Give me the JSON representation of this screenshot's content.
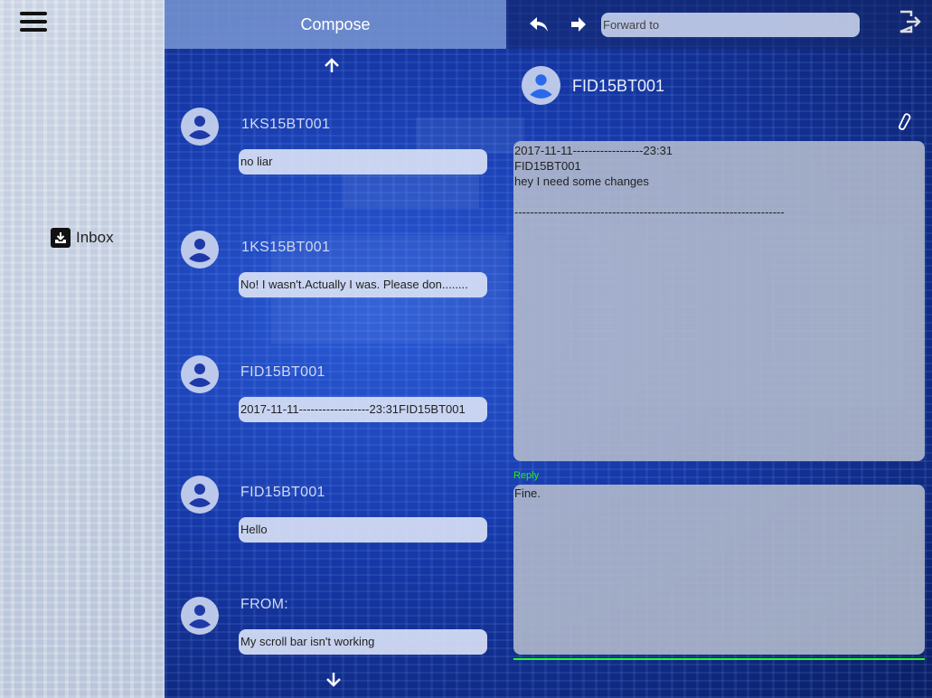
{
  "sidebar": {
    "inbox_label": "Inbox"
  },
  "middle": {
    "compose_label": "Compose",
    "messages": [
      {
        "sender": "1KS15BT001",
        "preview": "no liar"
      },
      {
        "sender": "1KS15BT001",
        "preview": "No! I wasn't.Actually I was. Please don........"
      },
      {
        "sender": "FID15BT001",
        "preview": "2017-11-11------------------23:31FID15BT001"
      },
      {
        "sender": "FID15BT001",
        "preview": "Hello"
      },
      {
        "sender": "FROM:",
        "preview": "My scroll bar isn't working"
      }
    ]
  },
  "right": {
    "forward_placeholder": "Forward to",
    "sender": "FID15BT001",
    "message_lines": [
      "2017-11-11------------------23:31",
      "FID15BT001",
      "hey I need some changes",
      "",
      "---------------------------------------------------------------------"
    ],
    "reply_label": "Reply",
    "reply_text": "Fine."
  },
  "colors": {
    "reply_label": "#22ee22",
    "accent_line": "#22ff22"
  }
}
